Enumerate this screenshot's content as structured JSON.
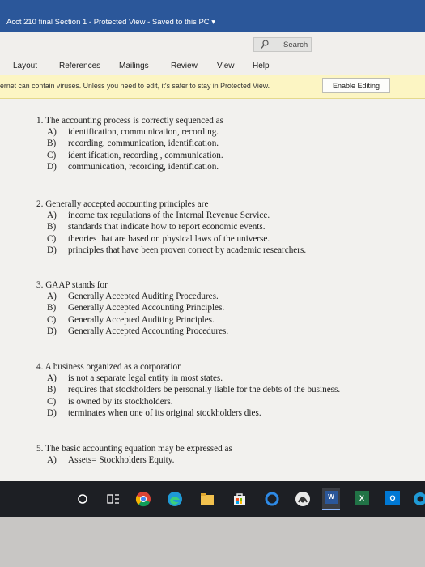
{
  "window": {
    "title": "Acct 210 final Section 1  -  Protected View  -  Saved to this PC  ▾",
    "search_label": "Search"
  },
  "ribbon": {
    "tabs": [
      "Layout",
      "References",
      "Mailings",
      "Review",
      "View",
      "Help"
    ]
  },
  "protected_view": {
    "message": "ernet can contain viruses. Unless you need to edit, it's safer to stay in Protected View.",
    "enable_button": "Enable Editing"
  },
  "questions": [
    {
      "stem": "1.  The accounting process is correctly sequenced as",
      "options": [
        {
          "letter": "A)",
          "text": "identification, communication, recording."
        },
        {
          "letter": "B)",
          "text": "recording, communication, identification."
        },
        {
          "letter": "C)",
          "text": "ident ification, recording , communication."
        },
        {
          "letter": "D)",
          "text": "communication, recording, identification."
        }
      ]
    },
    {
      "stem": "2.  Generally accepted accounting principles are",
      "options": [
        {
          "letter": "A)",
          "text": "income tax regulations of the Internal Revenue Service."
        },
        {
          "letter": "B)",
          "text": "standards that indicate how to report economic events."
        },
        {
          "letter": "C)",
          "text": "theories that are based on physical laws of the universe."
        },
        {
          "letter": "D)",
          "text": "principles that have been proven correct by academic researchers."
        }
      ]
    },
    {
      "stem": "3.  GAAP stands for",
      "options": [
        {
          "letter": "A)",
          "text": "Generally Accepted Auditing Procedures."
        },
        {
          "letter": "B)",
          "text": "Generally Accepted Accounting Principles."
        },
        {
          "letter": "C)",
          "text": "Generally Accepted Auditing Principles."
        },
        {
          "letter": "D)",
          "text": "Generally Accepted Accounting Procedures."
        }
      ]
    },
    {
      "stem": "4.  A business organized as a corporation",
      "options": [
        {
          "letter": "A)",
          "text": "is not a separate legal entity in most states."
        },
        {
          "letter": "B)",
          "text": "requires that stockholders be personally liable for the debts of the business."
        },
        {
          "letter": "C)",
          "text": "is owned by its stockholders."
        },
        {
          "letter": "D)",
          "text": "terminates when one of its original stockholders dies."
        }
      ]
    },
    {
      "stem": "5.  The basic accounting equation may be expressed as",
      "options": [
        {
          "letter": "A)",
          "text": "Assets= Stockholders Equity."
        }
      ]
    }
  ],
  "taskbar": {
    "icons": [
      "cortana-icon",
      "task-view-icon",
      "chrome-icon",
      "edge-icon",
      "file-explorer-icon",
      "store-icon",
      "cortana-ring-icon",
      "app-icon",
      "word-icon",
      "excel-icon",
      "outlook-icon",
      "edge-partial-icon"
    ],
    "word_label": "W",
    "excel_label": "X",
    "outlook_label": "O"
  },
  "colors": {
    "titlebar": "#2b579a",
    "banner": "#fcf5c3",
    "page": "#f2f1ee",
    "taskbar": "#1d1f24"
  }
}
